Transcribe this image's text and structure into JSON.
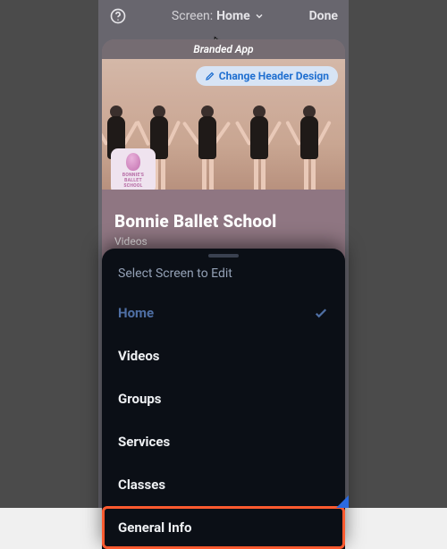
{
  "top": {
    "screen_prefix": "Screen:",
    "screen_value": "Home",
    "done": "Done"
  },
  "card": {
    "banner": "Branded App",
    "change_header": "Change Header Design",
    "logo_line1": "BONNIE'S",
    "logo_line2": "BALLET",
    "logo_line3": "SCHOOL",
    "title": "Bonnie Ballet School",
    "subtitle": "Videos"
  },
  "sheet": {
    "title": "Select Screen to Edit",
    "items": [
      {
        "label": "Home",
        "active": true
      },
      {
        "label": "Videos"
      },
      {
        "label": "Groups"
      },
      {
        "label": "Services"
      },
      {
        "label": "Classes"
      },
      {
        "label": "General Info",
        "highlight": true
      }
    ]
  }
}
